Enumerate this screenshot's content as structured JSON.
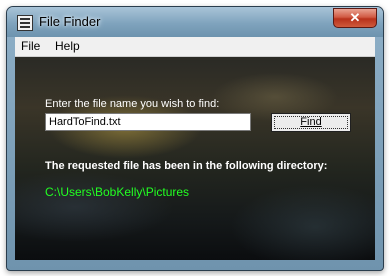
{
  "window": {
    "title": "File Finder",
    "close_label": "✕"
  },
  "menu": {
    "items": [
      "File",
      "Help"
    ]
  },
  "search": {
    "prompt": "Enter the file name you wish to find:",
    "value": "HardToFind.txt",
    "find_label": "Find"
  },
  "result": {
    "message": "The requested file has been in the following directory:",
    "path": "C:\\Users\\BobKelly\\Pictures"
  },
  "colors": {
    "result_path": "#22ff22",
    "close_button": "#c94a30"
  },
  "icons": {
    "app": "app-window-icon",
    "close": "close-icon"
  }
}
